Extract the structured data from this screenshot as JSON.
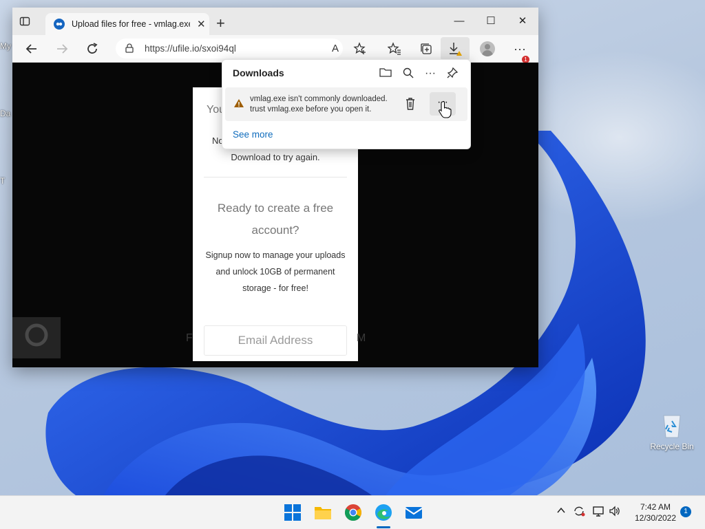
{
  "desktop": {
    "left_labels": [
      "My",
      "Da",
      "T"
    ],
    "recycle_bin_label": "Recycle Bin"
  },
  "browser": {
    "tab_title": "Upload files for free - vmlag.exe",
    "tab_close": "✕",
    "new_tab": "+",
    "window_controls": {
      "minimize": "—",
      "maximize": "☐",
      "close": "✕"
    },
    "url": "https://ufile.io/sxoi94ql",
    "reader_aloud": "A",
    "menu_badge": "1"
  },
  "page": {
    "trunc_heading": "You",
    "trunc_line": "No",
    "retry_text": "Download to try again.",
    "ready_text": "Ready to create a free account?",
    "signup_text": "Signup now to manage your uploads and unlock 10GB of permanent storage - for free!",
    "email_placeholder": "Email Address",
    "ghost_left": "F",
    "ghost_right": "M"
  },
  "downloads": {
    "title": "Downloads",
    "item_line1": "vmlag.exe isn't commonly downloaded.",
    "item_line2": "trust vmlag.exe before you open it.",
    "more_options": "···",
    "see_more": "See more"
  },
  "taskbar": {
    "time": "7:42 AM",
    "date": "12/30/2022",
    "notification_count": "1"
  },
  "colors": {
    "accent": "#0f6cbd",
    "warning": "#9d5d00",
    "badge": "#d32f2f"
  }
}
